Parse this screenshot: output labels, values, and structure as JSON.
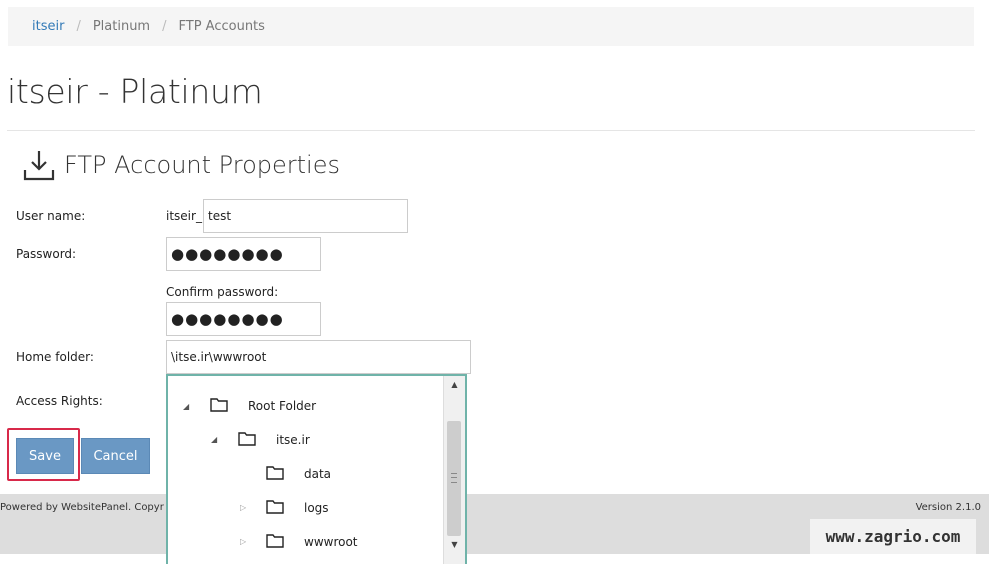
{
  "breadcrumb": {
    "items": [
      "itseir",
      "Platinum",
      "FTP Accounts"
    ],
    "separator": "/"
  },
  "page": {
    "title": "itseir - Platinum"
  },
  "section": {
    "title": "FTP Account Properties",
    "icon": "download-icon"
  },
  "form": {
    "username_label": "User name:",
    "username_prefix": "itseir_",
    "username_value": "test",
    "password_label": "Password:",
    "password_value": "●●●●●●●●",
    "confirm_label": "Confirm password:",
    "confirm_value": "●●●●●●●●",
    "home_label": "Home folder:",
    "home_value": "\\itse.ir\\wwwroot",
    "access_label": "Access Rights:"
  },
  "tree": {
    "nodes": [
      {
        "label": "Root Folder",
        "expanded": true
      },
      {
        "label": "itse.ir",
        "expanded": true
      },
      {
        "label": "data"
      },
      {
        "label": "logs",
        "collapsed": true
      },
      {
        "label": "wwwroot",
        "collapsed": true
      }
    ]
  },
  "buttons": {
    "save": "Save",
    "cancel": "Cancel"
  },
  "footer": {
    "left": "Powered by WebsitePanel. Copyr",
    "right": "Version 2.1.0"
  },
  "watermark": "www.zagrio.com",
  "colors": {
    "accent": "#337ab7",
    "button": "#6a98c4",
    "highlight": "#d8294a",
    "tree_border": "#6fb3a9"
  }
}
